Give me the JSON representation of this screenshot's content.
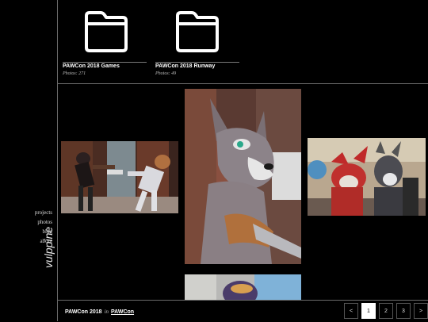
{
  "nav": {
    "items": [
      "projects",
      "photos",
      "blog",
      "about"
    ]
  },
  "logo": "vulppine",
  "folders": [
    {
      "title": "PAWCon 2018 Games",
      "count": "Photos: 271"
    },
    {
      "title": "PAWCon 2018 Runway",
      "count": "Photos: 49"
    }
  ],
  "footer": {
    "current": "PAWCon 2018",
    "in": "in",
    "parent": "PAWCon"
  },
  "pager": {
    "prev": "<",
    "pages": [
      "1",
      "2",
      "3"
    ],
    "next": ">",
    "active": "1"
  },
  "photos": [
    {
      "name": "photo-fursuits-tug"
    },
    {
      "name": "photo-wolf-fursuit-closeup"
    },
    {
      "name": "photo-fursuit-pair"
    },
    {
      "name": "photo-partial-bottom"
    }
  ]
}
